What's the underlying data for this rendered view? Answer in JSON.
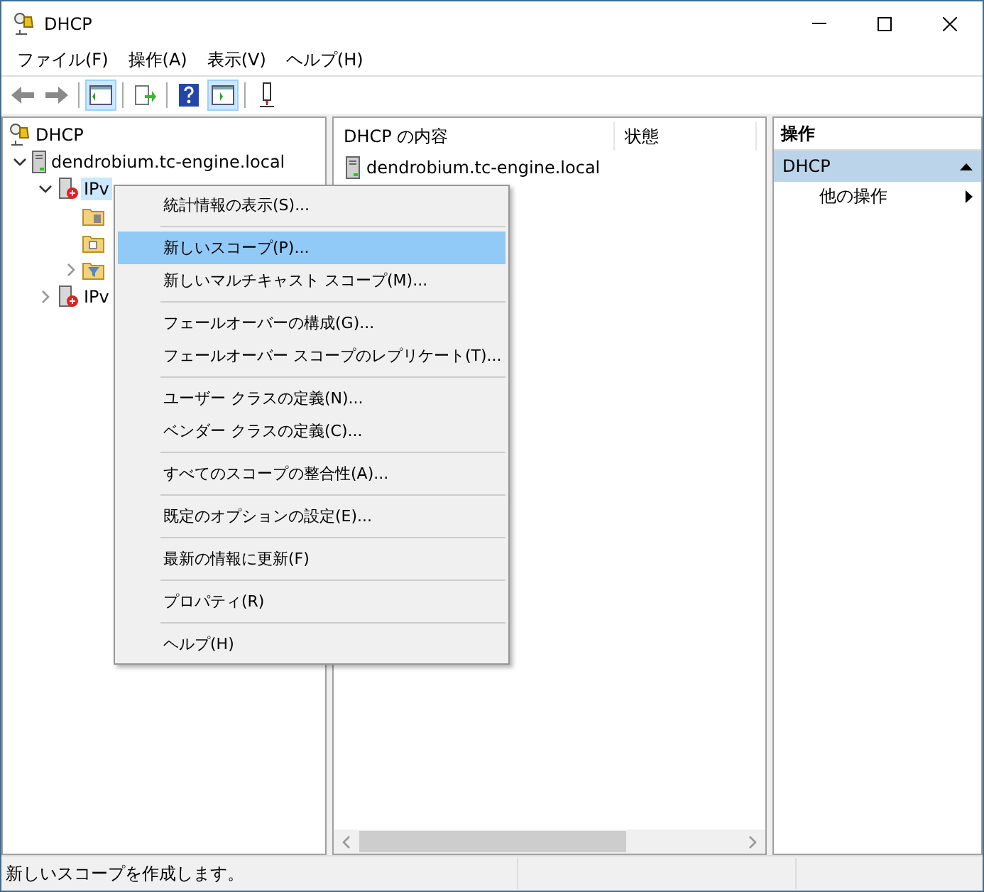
{
  "window": {
    "title": "DHCP"
  },
  "menu_bar": [
    "ファイル(F)",
    "操作(A)",
    "表示(V)",
    "ヘルプ(H)"
  ],
  "toolbar": [
    {
      "kind": "back",
      "pressed": false
    },
    {
      "kind": "forward",
      "pressed": false
    },
    {
      "kind": "separator"
    },
    {
      "kind": "tree-pane",
      "pressed": true
    },
    {
      "kind": "separator"
    },
    {
      "kind": "export",
      "pressed": false
    },
    {
      "kind": "separator"
    },
    {
      "kind": "help",
      "pressed": false
    },
    {
      "kind": "action-pane",
      "pressed": true
    },
    {
      "kind": "separator"
    },
    {
      "kind": "connect",
      "pressed": false
    }
  ],
  "tree": [
    {
      "label": "DHCP",
      "kind": "root",
      "selected": false,
      "children": [
        {
          "label": "dendrobium.tc-engine.local",
          "kind": "server",
          "selected": false,
          "expanded": true,
          "children": [
            {
              "label": "IPv",
              "kind": "ip",
              "selected": true,
              "expanded": true,
              "children": [
                {
                  "kind": "folder-server",
                  "expandable": false
                },
                {
                  "kind": "folder-lock",
                  "expandable": false
                },
                {
                  "kind": "folder-filter",
                  "expandable": true
                }
              ]
            },
            {
              "label": "IPv",
              "kind": "ip",
              "selected": false,
              "expanded": false
            }
          ]
        }
      ]
    }
  ],
  "content": {
    "columns": [
      "DHCP の内容",
      "状態"
    ],
    "rows": [
      {
        "name": "dendrobium.tc-engine.local"
      }
    ]
  },
  "actions": {
    "title": "操作",
    "section": "DHCP",
    "items": [
      "他の操作"
    ]
  },
  "context_menu": [
    [
      {
        "label": "統計情報の表示(S)...",
        "selected": false
      }
    ],
    [
      {
        "label": "新しいスコープ(P)...",
        "selected": true
      },
      {
        "label": "新しいマルチキャスト スコープ(M)...",
        "selected": false
      }
    ],
    [
      {
        "label": "フェールオーバーの構成(G)...",
        "selected": false
      },
      {
        "label": "フェールオーバー スコープのレプリケート(T)...",
        "selected": false
      }
    ],
    [
      {
        "label": "ユーザー クラスの定義(N)...",
        "selected": false
      },
      {
        "label": "ベンダー クラスの定義(C)...",
        "selected": false
      }
    ],
    [
      {
        "label": "すべてのスコープの整合性(A)...",
        "selected": false
      }
    ],
    [
      {
        "label": "既定のオプションの設定(E)...",
        "selected": false
      }
    ],
    [
      {
        "label": "最新の情報に更新(F)",
        "selected": false
      }
    ],
    [
      {
        "label": "プロパティ(R)",
        "selected": false
      }
    ],
    [
      {
        "label": "ヘルプ(H)",
        "selected": false
      }
    ]
  ],
  "status_bar": "新しいスコープを作成します。"
}
